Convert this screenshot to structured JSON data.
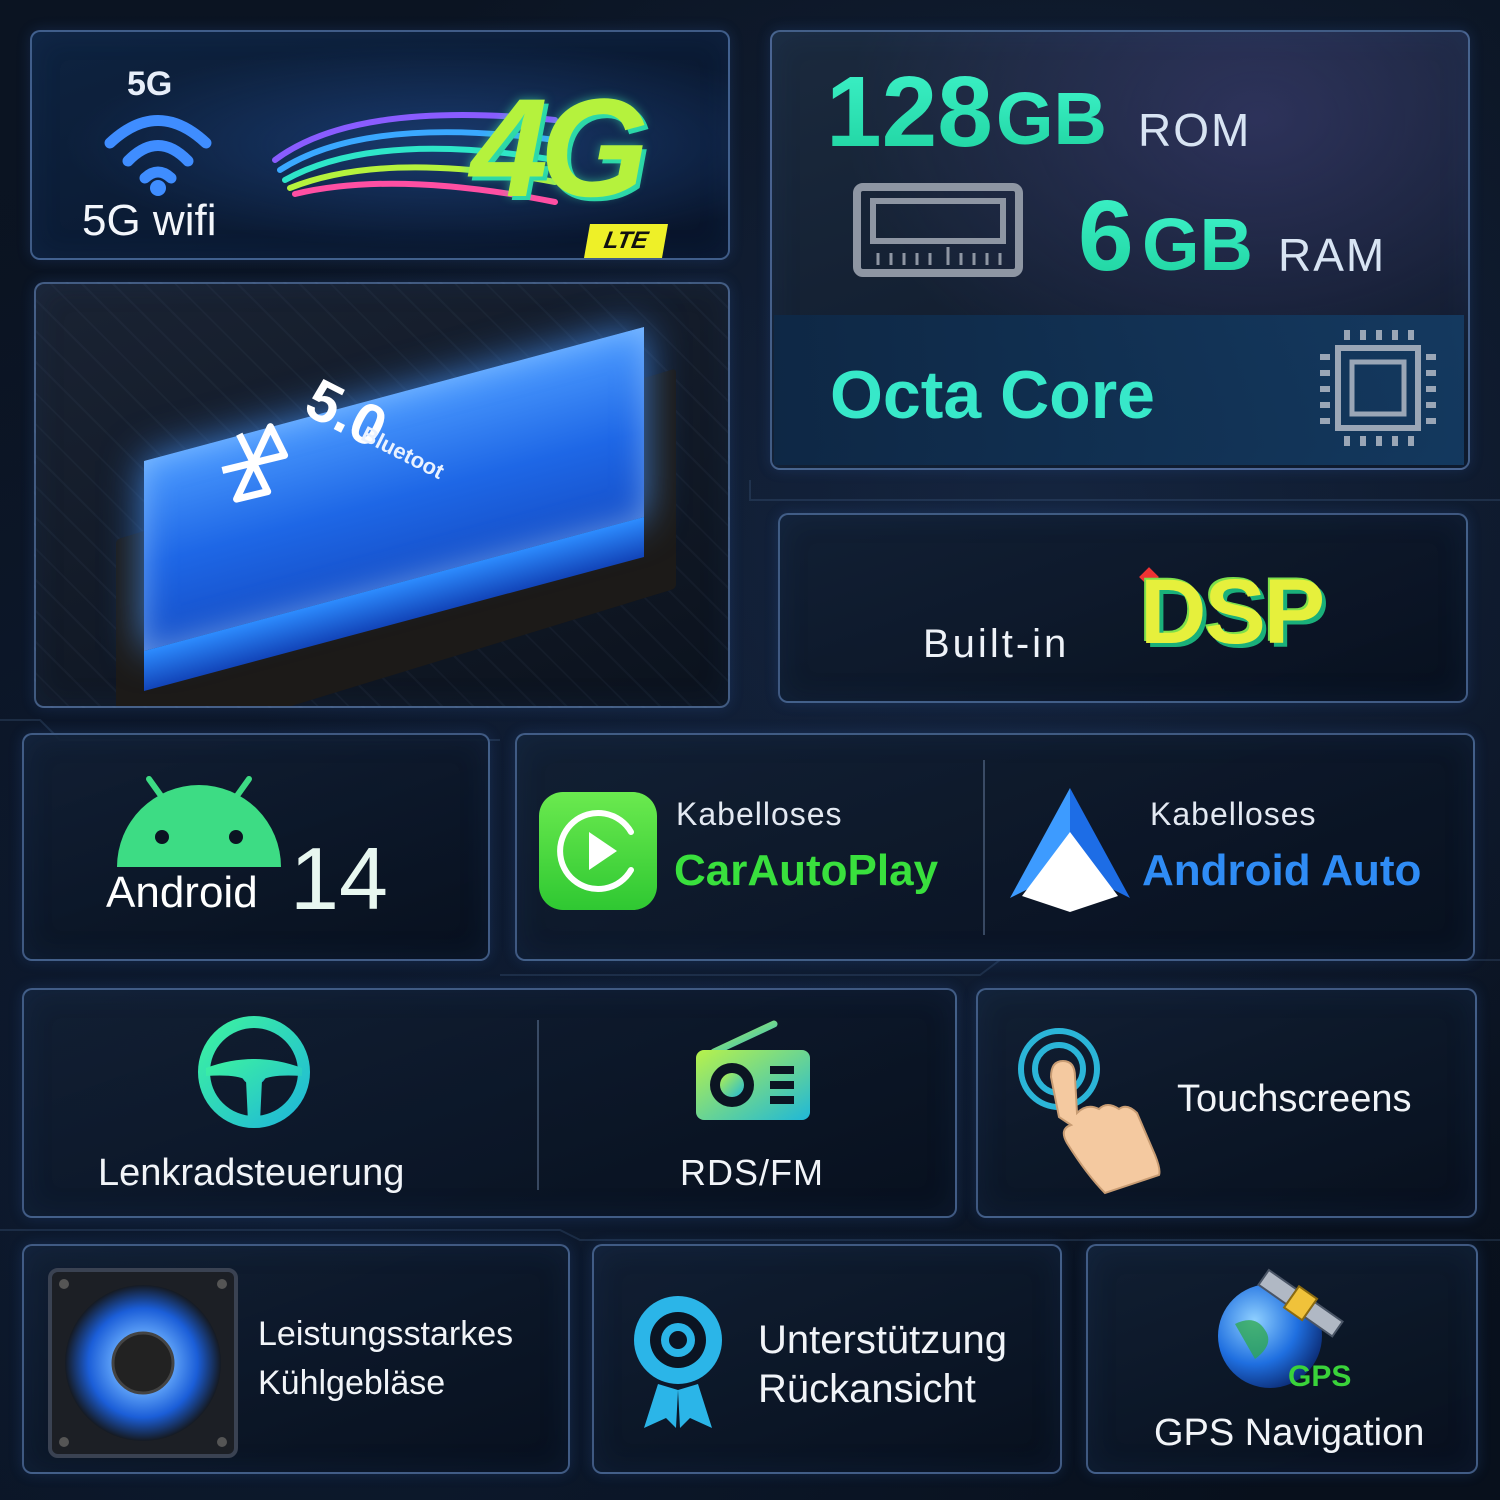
{
  "network": {
    "badge_5g": "5G",
    "wifi_label": "5G wifi",
    "label_4g": "4G",
    "label_lte": "LTE"
  },
  "bluetooth": {
    "version": "5.0",
    "word": "Bluetoot"
  },
  "memory": {
    "rom_value": "128",
    "rom_unit": "GB",
    "rom_label": "ROM",
    "ram_value": "6",
    "ram_unit": "GB",
    "ram_label": "RAM",
    "cpu_label": "Octa Core"
  },
  "dsp": {
    "prefix": "Built-in",
    "logo_text": "DSP"
  },
  "android": {
    "label": "Android",
    "version": "14"
  },
  "wireless": {
    "carplay_prefix": "Kabelloses",
    "carplay_name": "CarAutoPlay",
    "androidauto_prefix": "Kabelloses",
    "androidauto_name": "Android Auto"
  },
  "controls": {
    "steering_label": "Lenkradsteuerung",
    "radio_label": "RDS/FM",
    "touch_label": "Touchscreens"
  },
  "bottom": {
    "fan_line1": "Leistungsstarkes",
    "fan_line2": "Kühlgebläse",
    "camera_line1": "Unterstützung",
    "camera_line2": "Rückansicht",
    "gps_badge": "GPS",
    "gps_label": "GPS Navigation"
  },
  "colors": {
    "accent_teal": "#37e8c9",
    "carplay_green": "#39e03d",
    "androidauto_blue": "#2f8cf5",
    "dsp_yellow": "#e6f03c",
    "bluetooth_blue": "#1e67e6"
  },
  "icons": [
    "wifi-icon",
    "memory-module-icon",
    "cpu-chip-icon",
    "android-robot-icon",
    "carplay-icon",
    "android-auto-icon",
    "steering-wheel-icon",
    "radio-icon",
    "touch-hand-icon",
    "cooling-fan-icon",
    "camera-icon",
    "gps-satellite-globe-icon"
  ]
}
